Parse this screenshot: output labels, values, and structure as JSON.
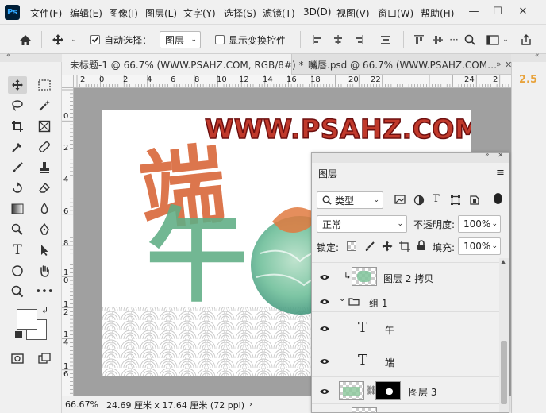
{
  "app": {
    "logo": "Ps"
  },
  "menu": [
    "文件(F)",
    "编辑(E)",
    "图像(I)",
    "图层(L)",
    "文字(Y)",
    "选择(S)",
    "滤镜(T)",
    "3D(D)",
    "视图(V)",
    "窗口(W)",
    "帮助(H)"
  ],
  "window_controls": {
    "minimize": "—",
    "maximize": "☐",
    "close": "✕"
  },
  "options": {
    "auto_select_label": "自动选择：",
    "auto_select_checked": true,
    "auto_select_target": "图层",
    "show_transform_label": "显示变换控件",
    "show_transform_checked": false
  },
  "tabs": [
    {
      "label": "未标题-1 @ 66.7% (WWW.PSAHZ.COM, RGB/8#) *",
      "active": true
    },
    {
      "label": "嘴唇.psd @ 66.7% (WWW.PSAHZ.COM…",
      "active": false
    }
  ],
  "ruler_h": [
    "2",
    "0",
    "2",
    "4",
    "6",
    "8",
    "10",
    "12",
    "14",
    "16",
    "18",
    "20",
    "22",
    "24",
    "2"
  ],
  "ruler_v": [
    "0",
    "2",
    "4",
    "6",
    "8",
    "1\n0",
    "1\n2",
    "1\n4",
    "1\n6"
  ],
  "canvas": {
    "watermark": "WWW.PSAHZ.COM",
    "char1": "端",
    "char2": "午"
  },
  "status": {
    "zoom": "66.67%",
    "doc_info": "24.69 厘米 x 17.64 厘米 (72 ppi)"
  },
  "right_panel": {
    "value": "2.5"
  },
  "layers_panel": {
    "title": "图层",
    "filter": "类型",
    "blend_mode": "正常",
    "opacity_label": "不透明度:",
    "opacity": "100%",
    "lock_label": "锁定:",
    "fill_label": "填充:",
    "fill": "100%",
    "layers": [
      {
        "name": "图层 2 拷贝",
        "kind": "image"
      },
      {
        "name": "组 1",
        "kind": "group"
      },
      {
        "name": "午",
        "kind": "text"
      },
      {
        "name": "端",
        "kind": "text"
      },
      {
        "name": "图层 3",
        "kind": "image-mask"
      }
    ]
  },
  "colors": {
    "accent": "#e8a33c",
    "watermark_fill": "#c0392b",
    "ps_blue": "#31a8ff"
  }
}
